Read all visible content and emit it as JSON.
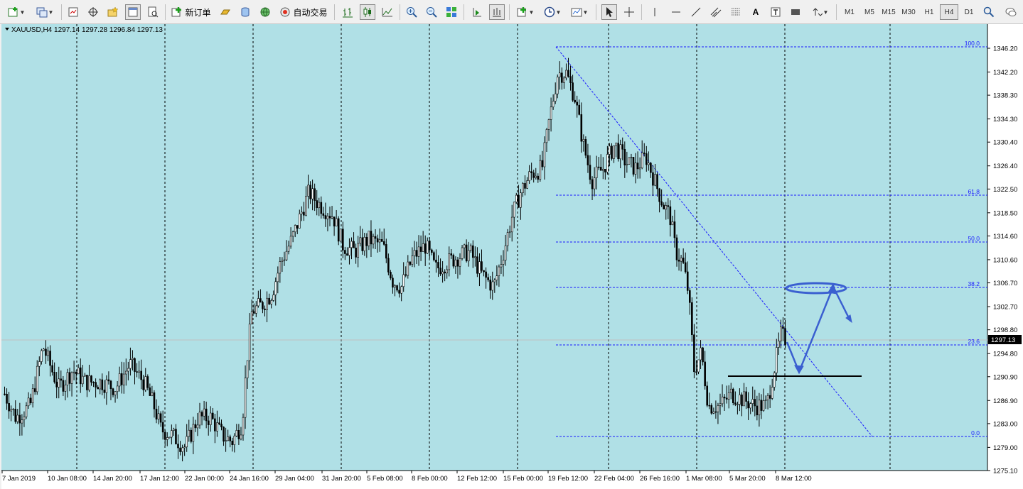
{
  "toolbar": {
    "new_order_label": "新订单",
    "auto_trade_label": "自动交易",
    "timeframes": [
      "M1",
      "M5",
      "M15",
      "M30",
      "H1",
      "H4",
      "D1"
    ],
    "active_timeframe": "H4"
  },
  "chart": {
    "header": "XAUUSD,H4  1297.14 1297.28 1296.84 1297.13",
    "background": "#b0e0e6",
    "current_price": "1297.13",
    "price_axis": [
      "1346.20",
      "1342.20",
      "1338.30",
      "1334.30",
      "1330.40",
      "1326.40",
      "1322.50",
      "1318.50",
      "1314.60",
      "1310.60",
      "1306.70",
      "1302.70",
      "1298.80",
      "1294.80",
      "1290.90",
      "1286.90",
      "1283.00",
      "1279.00",
      "1275.10"
    ],
    "time_axis": [
      "7 Jan 2019",
      "10 Jan 08:00",
      "14 Jan 20:00",
      "17 Jan 12:00",
      "22 Jan 00:00",
      "24 Jan 16:00",
      "29 Jan 04:00",
      "31 Jan 20:00",
      "5 Feb 08:00",
      "8 Feb 00:00",
      "12 Feb 12:00",
      "15 Feb 00:00",
      "19 Feb 12:00",
      "22 Feb 04:00",
      "26 Feb 16:00",
      "1 Mar 08:00",
      "5 Mar 20:00",
      "8 Mar 12:00"
    ],
    "fibonacci_levels": [
      "100.0",
      "61.8",
      "50.0",
      "38.2",
      "23.6",
      "0.0"
    ],
    "fib_color": "#1a1aff",
    "annotation_color": "#3a5fd0"
  }
}
